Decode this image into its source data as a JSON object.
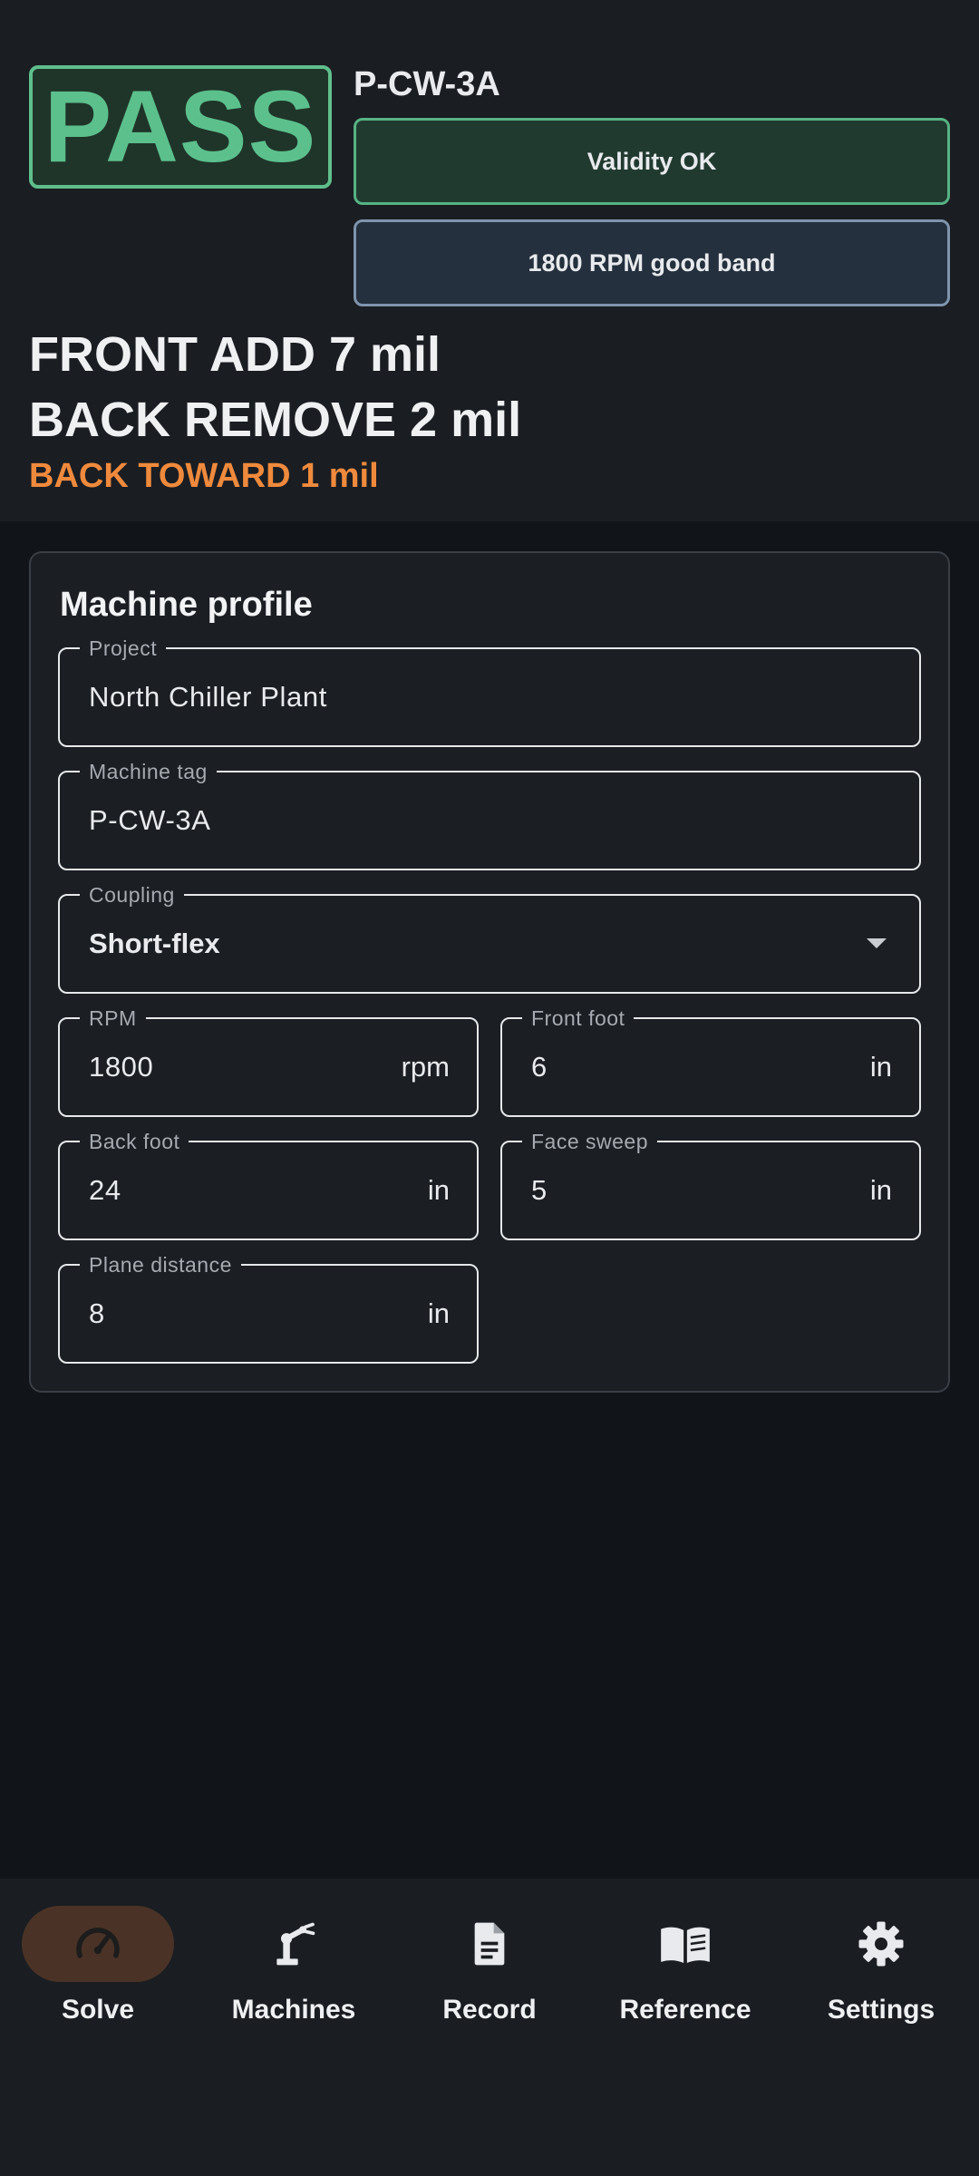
{
  "status": {
    "result": "PASS",
    "machine_tag": "P-CW-3A",
    "validity": "Validity OK",
    "rpm_band": "1800 RPM good band"
  },
  "instructions": {
    "line1": "FRONT ADD 7 mil",
    "line2": "BACK REMOVE 2 mil",
    "line3": "BACK TOWARD 1 mil"
  },
  "profile": {
    "title": "Machine profile",
    "project": {
      "label": "Project",
      "value": "North Chiller Plant"
    },
    "machine_tag": {
      "label": "Machine tag",
      "value": "P-CW-3A"
    },
    "coupling": {
      "label": "Coupling",
      "value": "Short-flex"
    },
    "rpm": {
      "label": "RPM",
      "value": "1800",
      "unit": "rpm"
    },
    "front_foot": {
      "label": "Front foot",
      "value": "6",
      "unit": "in"
    },
    "back_foot": {
      "label": "Back foot",
      "value": "24",
      "unit": "in"
    },
    "face_sweep": {
      "label": "Face sweep",
      "value": "5",
      "unit": "in"
    },
    "plane_distance": {
      "label": "Plane distance",
      "value": "8",
      "unit": "in"
    }
  },
  "nav": {
    "items": [
      {
        "label": "Solve",
        "icon": "gauge-icon",
        "active": true
      },
      {
        "label": "Machines",
        "icon": "robot-arm-icon",
        "active": false
      },
      {
        "label": "Record",
        "icon": "document-icon",
        "active": false
      },
      {
        "label": "Reference",
        "icon": "open-book-icon",
        "active": false
      },
      {
        "label": "Settings",
        "icon": "gear-icon",
        "active": false
      }
    ]
  },
  "colors": {
    "pass_green": "#5cc08d",
    "warning_orange": "#ef8a3d",
    "active_nav_bg": "#4a3326"
  }
}
